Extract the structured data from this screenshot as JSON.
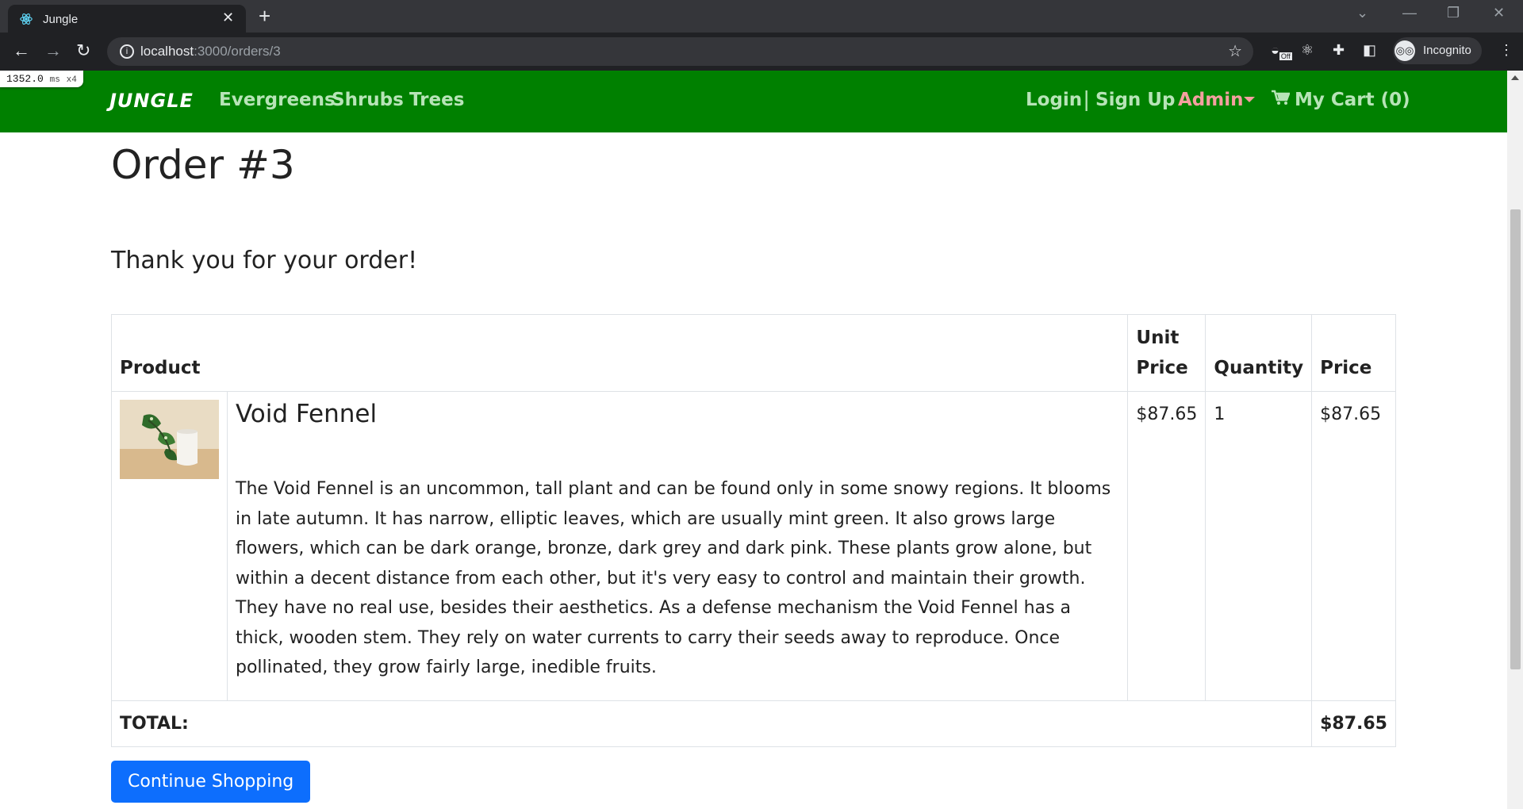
{
  "browser": {
    "tab_title": "Jungle",
    "url_host": "localhost",
    "url_path": ":3000/orders/3",
    "incognito_label": "Incognito",
    "ext_badge": "Off"
  },
  "perf": {
    "ms": "1352.0",
    "unit": "ms",
    "mult": "x4"
  },
  "navbar": {
    "brand": "JUNGLE",
    "links": [
      "Evergreens",
      "Shrubs",
      "Trees"
    ],
    "login": "Login",
    "separator": "|",
    "signup": "Sign Up",
    "admin": "Admin",
    "cart": "My Cart (0)"
  },
  "order": {
    "title": "Order #3",
    "thanks": "Thank you for your order!",
    "headers": {
      "product": "Product",
      "unit_price": "Unit Price",
      "quantity": "Quantity",
      "price": "Price"
    },
    "items": [
      {
        "name": "Void Fennel",
        "description": "The Void Fennel is an uncommon, tall plant and can be found only in some snowy regions. It blooms in late autumn. It has narrow, elliptic leaves, which are usually mint green. It also grows large flowers, which can be dark orange, bronze, dark grey and dark pink. These plants grow alone, but within a decent distance from each other, but it's very easy to control and maintain their growth. They have no real use, besides their aesthetics. As a defense mechanism the Void Fennel has a thick, wooden stem. They rely on water currents to carry their seeds away to reproduce. Once pollinated, they grow fairly large, inedible fruits.",
        "unit_price": "$87.65",
        "quantity": "1",
        "price": "$87.65"
      }
    ],
    "total_label": "TOTAL:",
    "total": "$87.65",
    "continue_label": "Continue Shopping"
  },
  "colors": {
    "navbar": "#008000",
    "button": "#0d6efd",
    "admin": "#f4a0a0"
  }
}
